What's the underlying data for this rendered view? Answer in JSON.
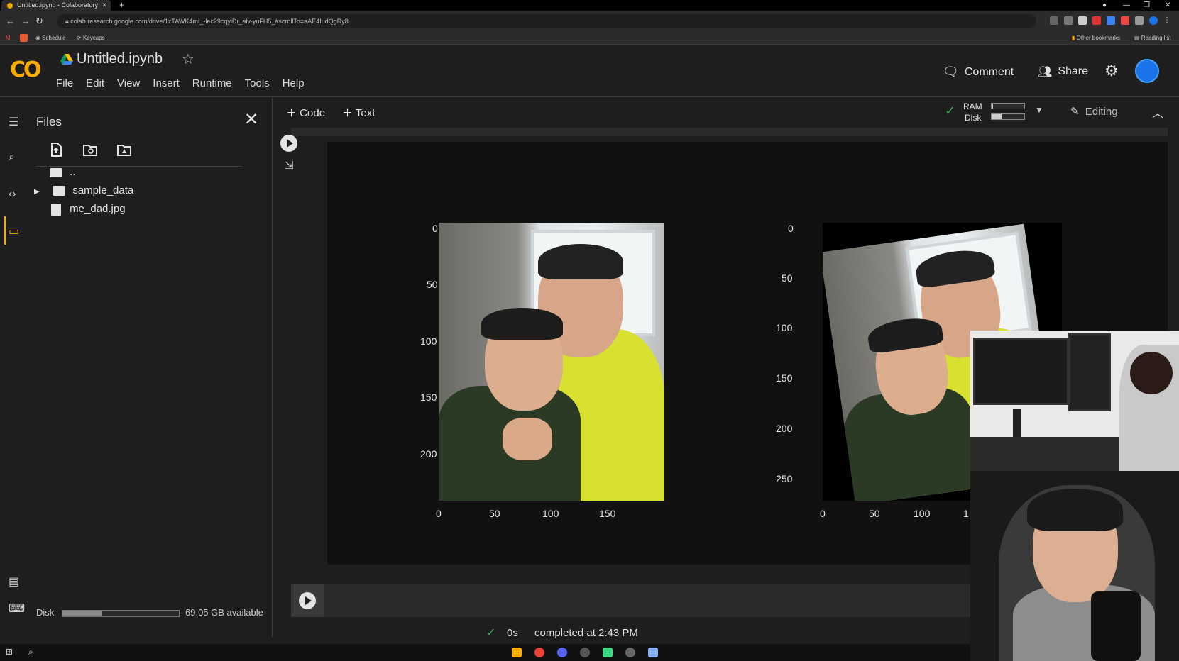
{
  "browser": {
    "tab_title": "Untitled.ipynb - Colaboratory",
    "new_tab": "+",
    "tab_close": "×",
    "url": "colab.research.google.com/drive/1zTAWK4mI_-lec29cqyiDr_alv-yuFH5_#scrollTo=aAE4IudQgRy8",
    "bookmarks": [
      "Schedule",
      "Keycaps"
    ],
    "bookmarks_right": [
      "Other bookmarks",
      "Reading list"
    ],
    "window_controls": [
      "—",
      "❐",
      "✕"
    ]
  },
  "colab": {
    "logo": "CO",
    "notebook_title": "Untitled.ipynb",
    "menu": [
      "File",
      "Edit",
      "View",
      "Insert",
      "Runtime",
      "Tools",
      "Help"
    ],
    "comment_label": "Comment",
    "share_label": "Share"
  },
  "files_panel": {
    "title": "Files",
    "tree": [
      {
        "name": "..",
        "type": "parent"
      },
      {
        "name": "sample_data",
        "type": "folder"
      },
      {
        "name": "me_dad.jpg",
        "type": "file"
      }
    ],
    "disk_label": "Disk",
    "disk_available": "69.05 GB available",
    "disk_used_fraction": 0.34
  },
  "toolbar": {
    "add_code": "Code",
    "add_text": "Text",
    "ram_label": "RAM",
    "disk_label": "Disk",
    "ram_fraction": 0.05,
    "disk_fraction": 0.3,
    "editing_label": "Editing"
  },
  "output": {
    "plot1": {
      "yticks": [
        "0",
        "50",
        "100",
        "150",
        "200"
      ],
      "xticks": [
        "0",
        "50",
        "100",
        "150"
      ]
    },
    "plot2": {
      "yticks": [
        "0",
        "50",
        "100",
        "150",
        "200",
        "250"
      ],
      "xticks": [
        "0",
        "50",
        "100",
        "1"
      ]
    }
  },
  "status": {
    "duration": "0s",
    "message": "completed at 2:43 PM"
  },
  "colors": {
    "accent_orange": "#f9ab00",
    "success_green": "#34a853"
  }
}
